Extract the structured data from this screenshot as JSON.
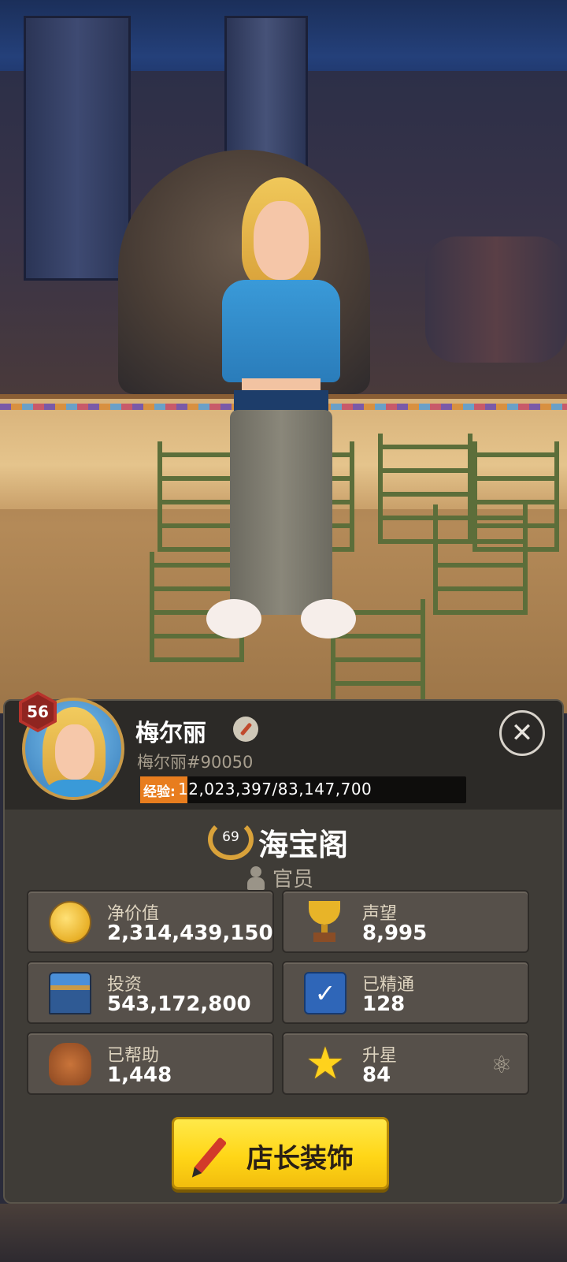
{
  "player": {
    "level": "56",
    "name": "梅尔丽",
    "id": "梅尔丽#90050",
    "exp_label": "经验:",
    "exp_text": "12,023,397/83,147,700",
    "exp_progress": 0.1446
  },
  "guild": {
    "level": "69",
    "name": "海宝阁",
    "rank": "官员"
  },
  "stats": [
    {
      "label": "净价值",
      "value": "2,314,439,150",
      "icon": "gold-coin-icon"
    },
    {
      "label": "声望",
      "value": "8,995",
      "icon": "trophy-icon"
    },
    {
      "label": "投资",
      "value": "543,172,800",
      "icon": "tower-icon"
    },
    {
      "label": "已精通",
      "value": "128",
      "icon": "mastery-checkbook-icon"
    },
    {
      "label": "已帮助",
      "value": "1,448",
      "icon": "fist-bump-icon"
    },
    {
      "label": "升星",
      "value": "84",
      "icon": "star-icon"
    }
  ],
  "actions": {
    "decorate_label": "店长装饰"
  },
  "colors": {
    "panel_bg": "#3f3c37",
    "exp_fill": "#e87d1e",
    "button_yellow": "#ffd617",
    "level_badge": "#b8332c"
  }
}
